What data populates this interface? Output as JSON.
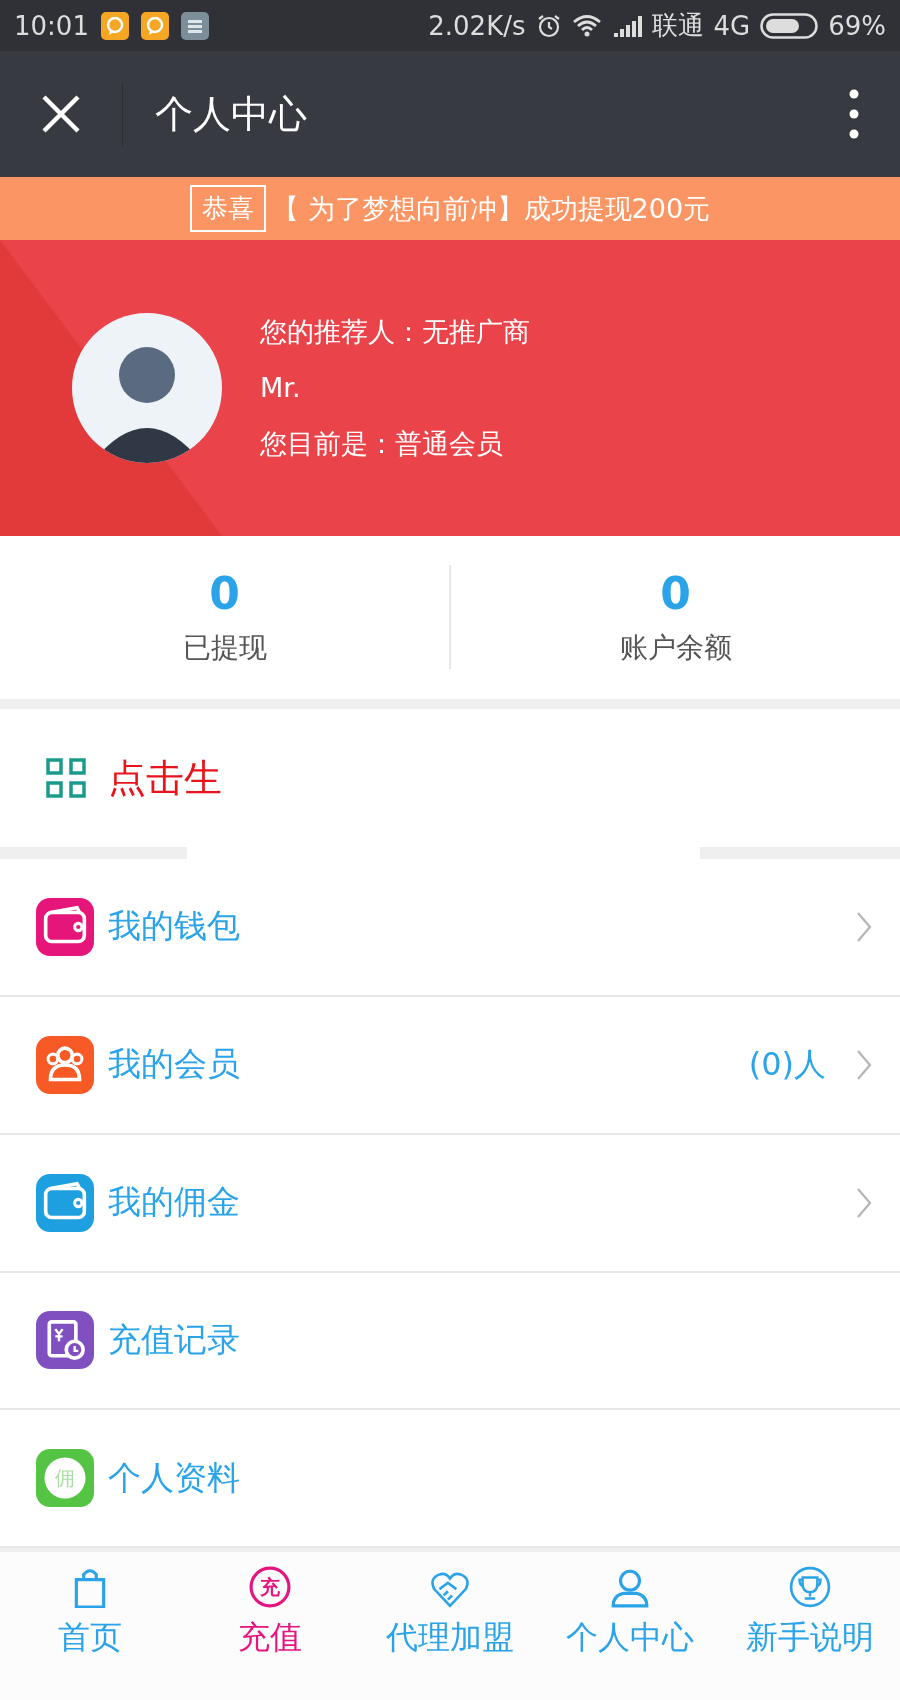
{
  "status_bar": {
    "time": "10:01",
    "speed": "2.02K/s",
    "carrier": "联通",
    "network": "4G",
    "battery": "69%"
  },
  "title_bar": {
    "title": "个人中心"
  },
  "notice": {
    "tag": "恭喜",
    "text": "【 为了梦想向前冲】成功提现200元"
  },
  "profile": {
    "referrer": "您的推荐人：无推广商",
    "name": "Mr.",
    "level": "您目前是：普通会员"
  },
  "stats": [
    {
      "value": "0",
      "label": "已提现"
    },
    {
      "value": "0",
      "label": "账户余额"
    }
  ],
  "qr_row": {
    "text": "点击生"
  },
  "menu": [
    {
      "kind": "wallet",
      "label": "我的钱包",
      "color": "#e5157a",
      "chevron": true
    },
    {
      "kind": "members",
      "label": "我的会员",
      "color": "#f85a25",
      "count": "(0)人",
      "chevron": true
    },
    {
      "kind": "wallet",
      "label": "我的佣金",
      "color": "#1e9fe0",
      "chevron": true
    },
    {
      "kind": "record",
      "label": "充值记录",
      "color": "#8050c0",
      "chevron": false
    },
    {
      "kind": "glyph",
      "label": "个人资料",
      "color": "#55c445",
      "glyph": "佣",
      "chevron": false
    }
  ],
  "tabs": [
    {
      "kind": "bag",
      "label": "首页",
      "selected": false
    },
    {
      "kind": "glyph",
      "glyph": "充",
      "label": "充值",
      "selected": true
    },
    {
      "kind": "handshake",
      "label": "代理加盟",
      "selected": false
    },
    {
      "kind": "person",
      "label": "个人中心",
      "selected": false
    },
    {
      "kind": "trophy",
      "label": "新手说明",
      "selected": false
    }
  ]
}
